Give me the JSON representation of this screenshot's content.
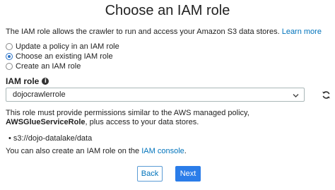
{
  "dialog": {
    "title": "Choose an IAM role",
    "intro_text": "The IAM role allows the crawler to run and access your Amazon S3 data stores.",
    "learn_more": "Learn more",
    "radio_options": [
      {
        "label": "Update a policy in an IAM role",
        "selected": false
      },
      {
        "label": "Choose an existing IAM role",
        "selected": true
      },
      {
        "label": "Create an IAM role",
        "selected": false
      }
    ],
    "iam_role_label": "IAM role",
    "iam_role_value": "dojocrawlerrole",
    "notice_prefix": "This role must provide permissions similar to the AWS managed policy,",
    "notice_policy": "AWSGlueServiceRole",
    "notice_suffix": ", plus access to your data stores.",
    "data_store": "s3://dojo-datalake/data",
    "alt_prefix": "You can also create an IAM role on the",
    "alt_link": "IAM console",
    "alt_suffix": ".",
    "back_label": "Back",
    "next_label": "Next"
  },
  "icons": {
    "info": "info-icon",
    "dropdown": "chevron-down-icon",
    "refresh": "refresh-icon",
    "radio": "radio-icon"
  },
  "colors": {
    "link": "#0073bb",
    "primary_button": "#2b7de9",
    "radio_selected": "#2b73c7"
  }
}
